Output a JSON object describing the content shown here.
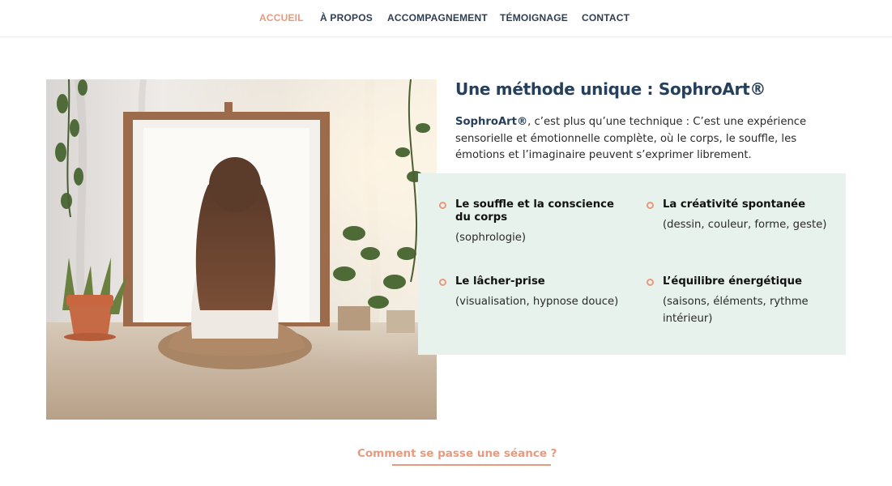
{
  "nav": {
    "items": [
      {
        "label": "ACCUEIL",
        "active": true
      },
      {
        "label": "À PROPOS",
        "active": false
      },
      {
        "label": "ACCOMPAGNEMENT",
        "active": false
      },
      {
        "label": "TÉMOIGNAGE",
        "active": false
      },
      {
        "label": "CONTACT",
        "active": false
      }
    ]
  },
  "hero_image": {
    "subject": "woman sitting cross-legged in front of a blank canvas surrounded by plants"
  },
  "section": {
    "title": "Une méthode unique : SophroArt®",
    "intro_brand": "SophroArt®",
    "intro_text": ", c’est plus qu’une technique :  C’est une expérience sensorielle et émotionnelle complète, où le corps, le souffle, les émotions et l’imaginaire peuvent s’exprimer librement."
  },
  "features": [
    {
      "title": "Le souffle et la conscience du corps",
      "subtitle": "(sophrologie)"
    },
    {
      "title": "La créativité spontanée",
      "subtitle": "(dessin, couleur, forme, geste)"
    },
    {
      "title": "Le lâcher-prise",
      "subtitle": "(visualisation, hypnose douce)"
    },
    {
      "title": "L’équilibre énergétique",
      "subtitle": "(saisons, éléments, rythme intérieur)"
    }
  ],
  "cta": {
    "label": "Comment se passe une séance ?"
  },
  "colors": {
    "accent": "#e89a7e",
    "navy": "#26405c",
    "box_bg": "#e8f2ec"
  }
}
